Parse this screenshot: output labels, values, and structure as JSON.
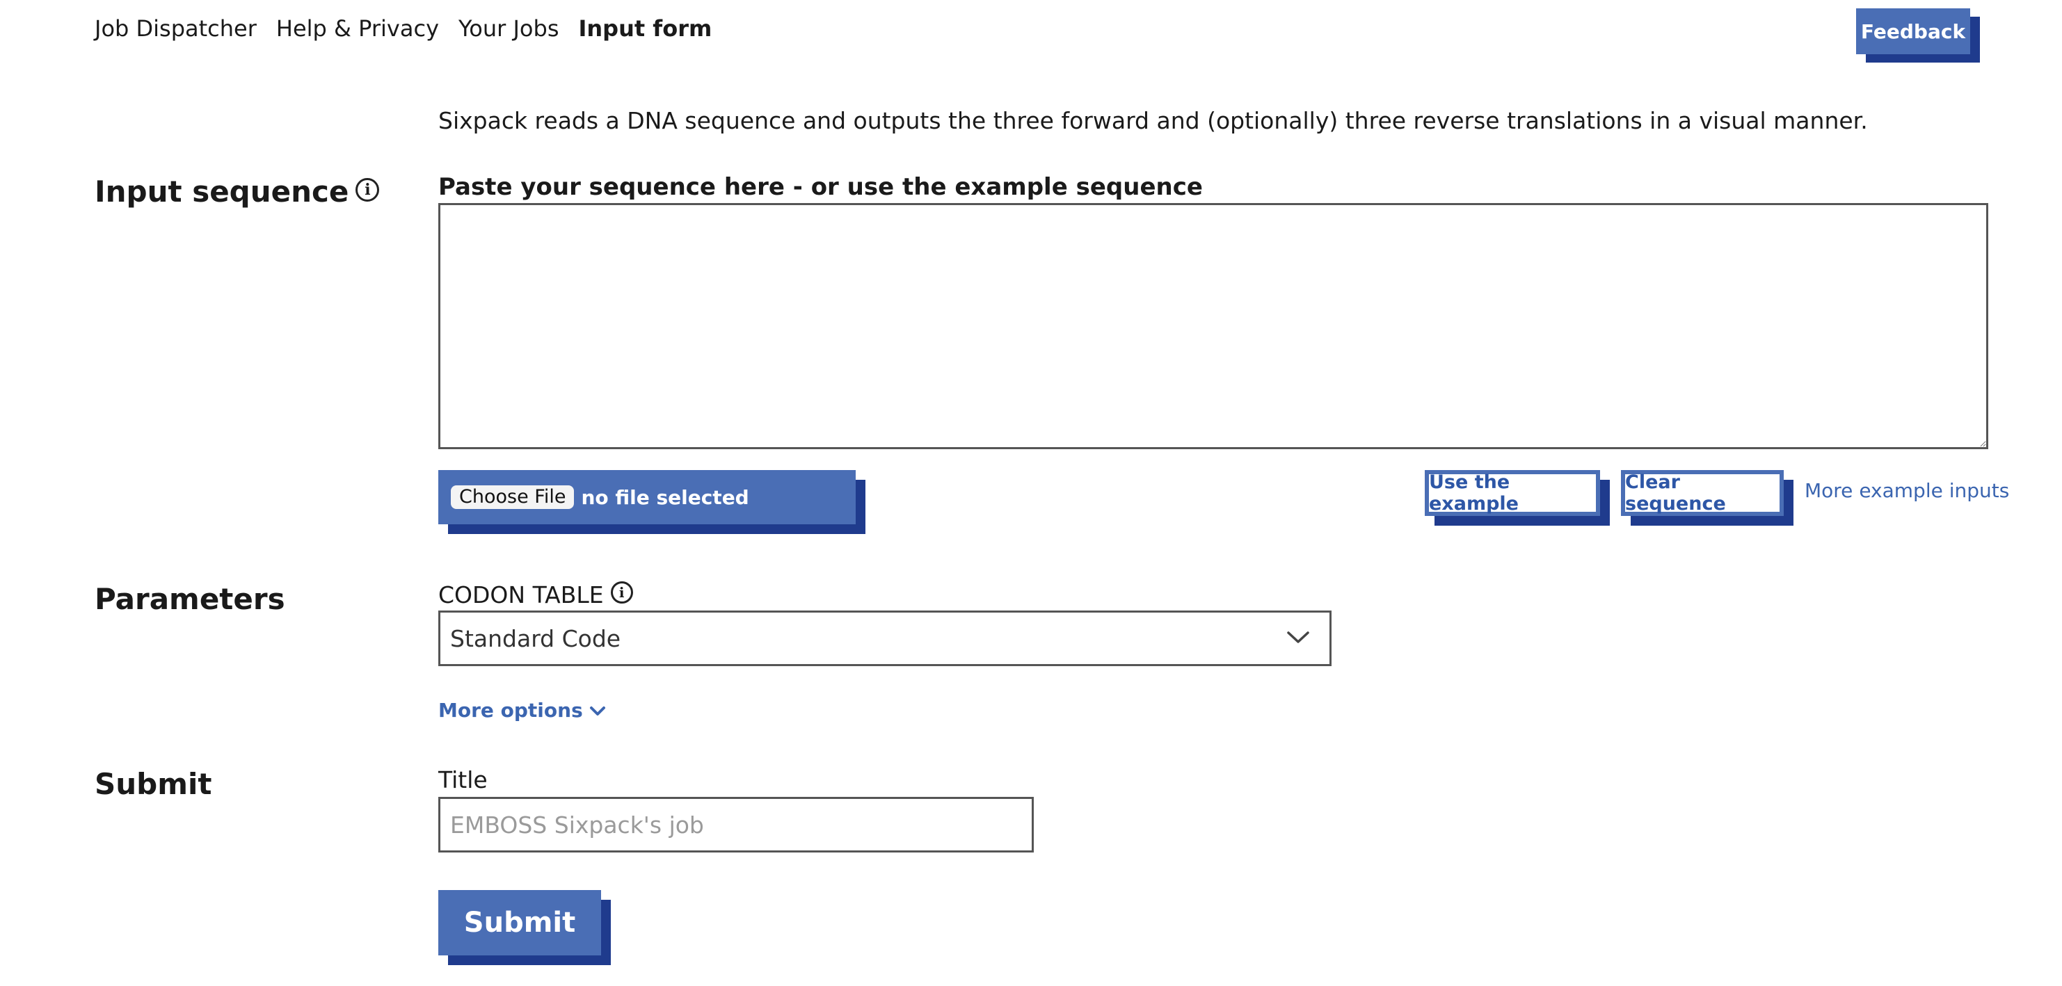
{
  "nav": {
    "items": [
      {
        "label": "Job Dispatcher",
        "active": false
      },
      {
        "label": "Help & Privacy",
        "active": false
      },
      {
        "label": "Your Jobs",
        "active": false
      },
      {
        "label": "Input form",
        "active": true
      }
    ],
    "feedback_label": "Feedback"
  },
  "intro": "Sixpack reads a DNA sequence and outputs the three forward and (optionally) three reverse translations in a visual manner.",
  "input_section": {
    "title": "Input sequence",
    "paste_label": "Paste your sequence here - or use the example sequence",
    "sequence_value": "",
    "choose_file_label": "Choose File",
    "file_status": "no file selected",
    "use_example_label": "Use the example",
    "clear_label": "Clear sequence",
    "more_examples_label": "More example inputs"
  },
  "params_section": {
    "title": "Parameters",
    "codon_label": "CODON TABLE",
    "codon_selected": "Standard Code",
    "more_options_label": "More options"
  },
  "submit_section": {
    "title": "Submit",
    "title_label": "Title",
    "title_placeholder": "EMBOSS Sixpack's job",
    "submit_label": "Submit"
  },
  "colors": {
    "primary": "#4a6eb5",
    "shadow": "#1f3b8d",
    "link": "#3b65b0"
  },
  "icons": [
    "info-icon",
    "chevron-down-icon"
  ]
}
